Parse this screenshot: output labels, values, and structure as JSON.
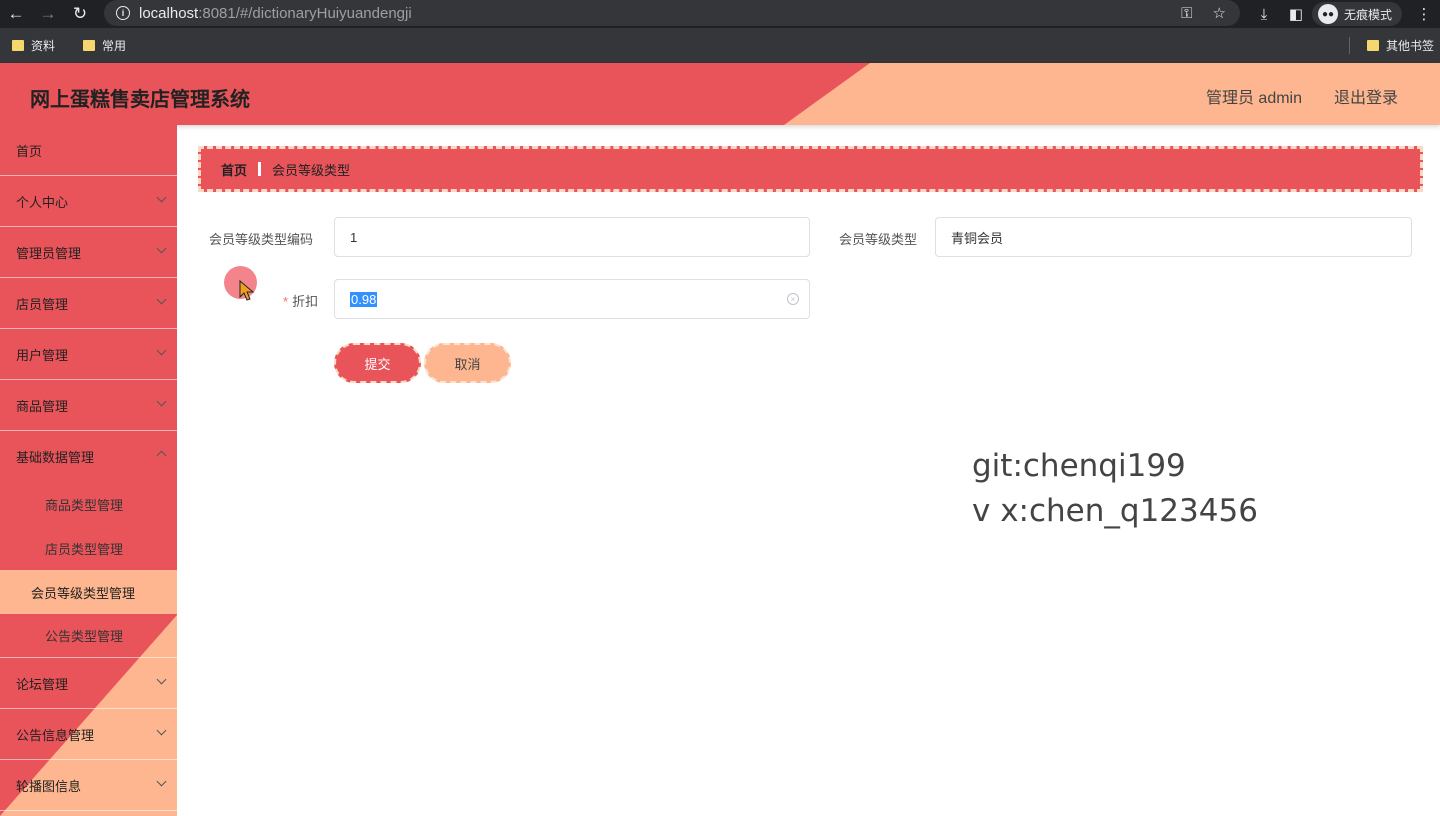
{
  "browser": {
    "url_host": "localhost",
    "url_path": ":8081/#/dictionaryHuiyuandengji",
    "incognito_label": "无痕模式",
    "bookmarks": [
      "资料",
      "常用"
    ],
    "other_bookmarks": "其他书签",
    "icons": [
      "back-icon",
      "forward-icon",
      "reload-icon",
      "info-icon",
      "key-icon",
      "star-icon",
      "download-icon",
      "sidepanel-icon",
      "incognito-icon",
      "menu-dots-icon"
    ]
  },
  "header": {
    "title": "网上蛋糕售卖店管理系统",
    "user": "管理员 admin",
    "logout": "退出登录"
  },
  "sidebar": {
    "items": [
      {
        "label": "首页"
      },
      {
        "label": "个人中心"
      },
      {
        "label": "管理员管理"
      },
      {
        "label": "店员管理"
      },
      {
        "label": "用户管理"
      },
      {
        "label": "商品管理"
      },
      {
        "label": "基础数据管理"
      },
      {
        "label": "论坛管理"
      },
      {
        "label": "公告信息管理"
      },
      {
        "label": "轮播图信息"
      }
    ],
    "sub_items": [
      "商品类型管理",
      "店员类型管理",
      "会员等级类型管理",
      "公告类型管理"
    ]
  },
  "breadcrumb": {
    "home": "首页",
    "current": "会员等级类型"
  },
  "form": {
    "code_label": "会员等级类型编码",
    "code_value": "1",
    "type_label": "会员等级类型",
    "type_value": "青铜会员",
    "discount_required": "*",
    "discount_label": "折扣",
    "discount_value": "0.98",
    "submit": "提交",
    "cancel": "取消"
  },
  "watermark": {
    "line1": "git:chenqi199",
    "line2": "v x:chen_q123456"
  },
  "colors": {
    "primary": "#e9545a",
    "secondary": "#fdb68f"
  }
}
